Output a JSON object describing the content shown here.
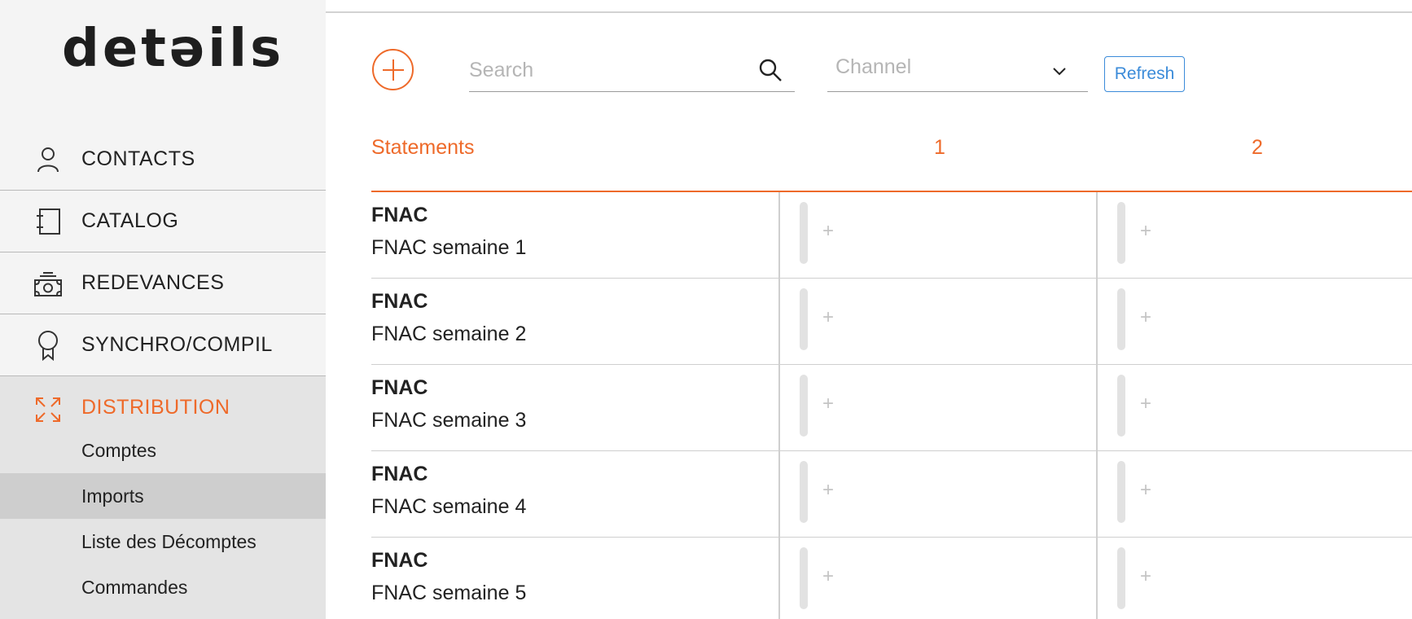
{
  "app": {
    "logo_text": "detəils"
  },
  "sidebar": {
    "items": [
      {
        "label": "CONTACTS",
        "icon": "person-icon"
      },
      {
        "label": "CATALOG",
        "icon": "catalog-icon"
      },
      {
        "label": "REDEVANCES",
        "icon": "money-icon"
      },
      {
        "label": "SYNCHRO/COMPIL",
        "icon": "award-icon"
      },
      {
        "label": "DISTRIBUTION",
        "icon": "expand-icon",
        "active": true
      }
    ],
    "subitems": [
      {
        "label": "Comptes"
      },
      {
        "label": "Imports",
        "selected": true
      },
      {
        "label": "Liste des Décomptes"
      },
      {
        "label": "Commandes"
      }
    ]
  },
  "toolbar": {
    "search_placeholder": "Search",
    "channel_placeholder": "Channel",
    "refresh_label": "Refresh"
  },
  "table": {
    "headers": [
      "Statements",
      "1",
      "2"
    ],
    "rows": [
      {
        "title": "FNAC",
        "subtitle": "FNAC semaine 1"
      },
      {
        "title": "FNAC",
        "subtitle": "FNAC semaine 2"
      },
      {
        "title": "FNAC",
        "subtitle": "FNAC semaine 3"
      },
      {
        "title": "FNAC",
        "subtitle": "FNAC semaine 4"
      },
      {
        "title": "FNAC",
        "subtitle": "FNAC semaine 5"
      }
    ],
    "cell_symbol": "+"
  },
  "colors": {
    "accent": "#ee6a2a",
    "link": "#3b8bd9",
    "sidebar_bg": "#f4f4f4",
    "active_bg": "#e4e4e4",
    "selected_bg": "#cecece"
  }
}
